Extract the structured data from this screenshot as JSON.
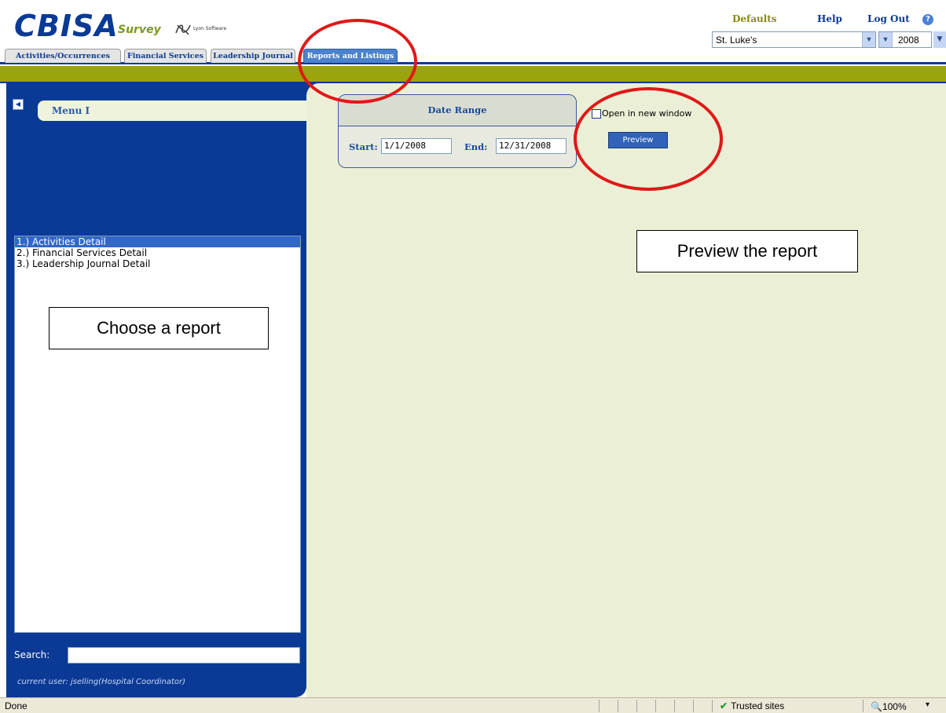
{
  "header": {
    "logo": "CBISA",
    "logo_sub": "Survey",
    "lyon_text": "Lyon Software",
    "links": {
      "defaults": "Defaults",
      "help": "Help",
      "logout": "Log Out"
    },
    "hospital_select": "St. Luke's",
    "year_select": "2008"
  },
  "tabs": [
    "Activities/Occurrences",
    "Financial Services",
    "Leadership Journal",
    "Reports and Listings"
  ],
  "sidebar": {
    "menu_label": "Menu I",
    "reports": [
      "1.) Activities Detail",
      "2.) Financial Services Detail",
      "3.) Leadership Journal Detail"
    ],
    "search_label": "Search:",
    "search_value": "",
    "current_user": "current user: jselling(Hospital Coordinator)"
  },
  "date_range": {
    "title": "Date Range",
    "start_label": "Start:",
    "start_value": "1/1/2008",
    "end_label": "End:",
    "end_value": "12/31/2008"
  },
  "options": {
    "open_new_window": "Open in new window",
    "preview_button": "Preview"
  },
  "callouts": {
    "preview": "Preview the report",
    "choose": "Choose a report"
  },
  "statusbar": {
    "status": "Done",
    "zone": "Trusted sites",
    "zoom": "100%"
  },
  "colors": {
    "brand_blue": "#0a3a96",
    "olive_bar": "#9aa40c",
    "content_bg": "#ebefd6",
    "annotation_red": "#e01818"
  }
}
